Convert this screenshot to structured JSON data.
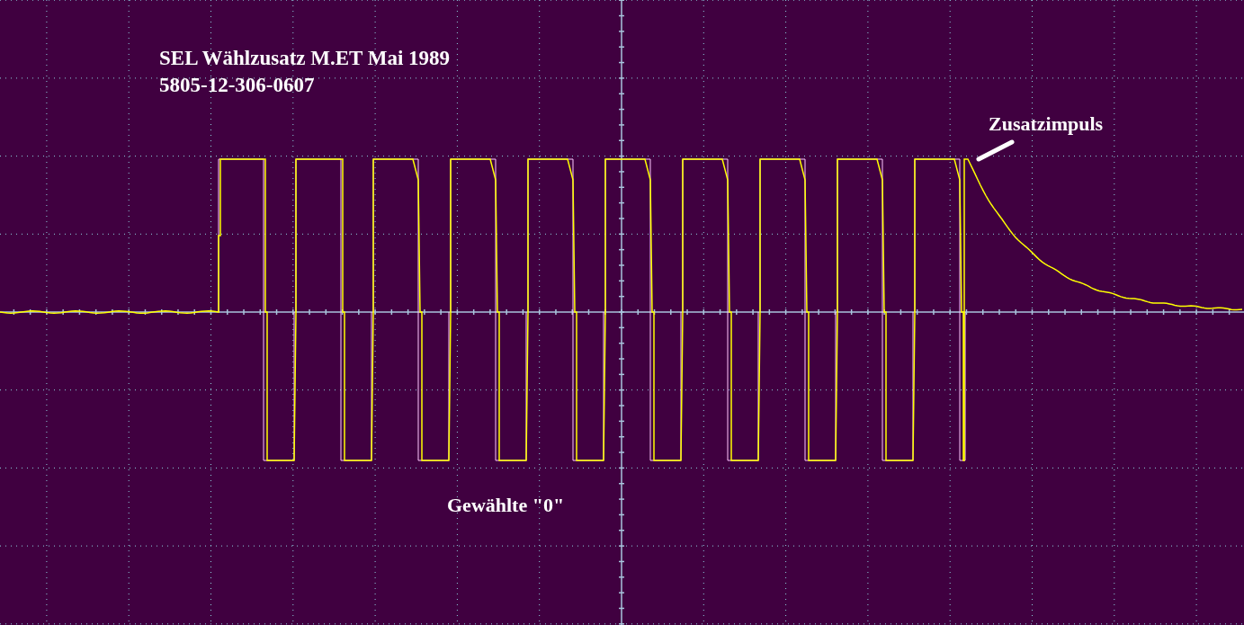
{
  "title_lines": [
    "SEL Wählzusatz M.ET Mai 1989",
    "5805-12-306-0607"
  ],
  "pulse_label": "Zusatzimpuls",
  "digit_label": "Gewählte \"0\""
}
